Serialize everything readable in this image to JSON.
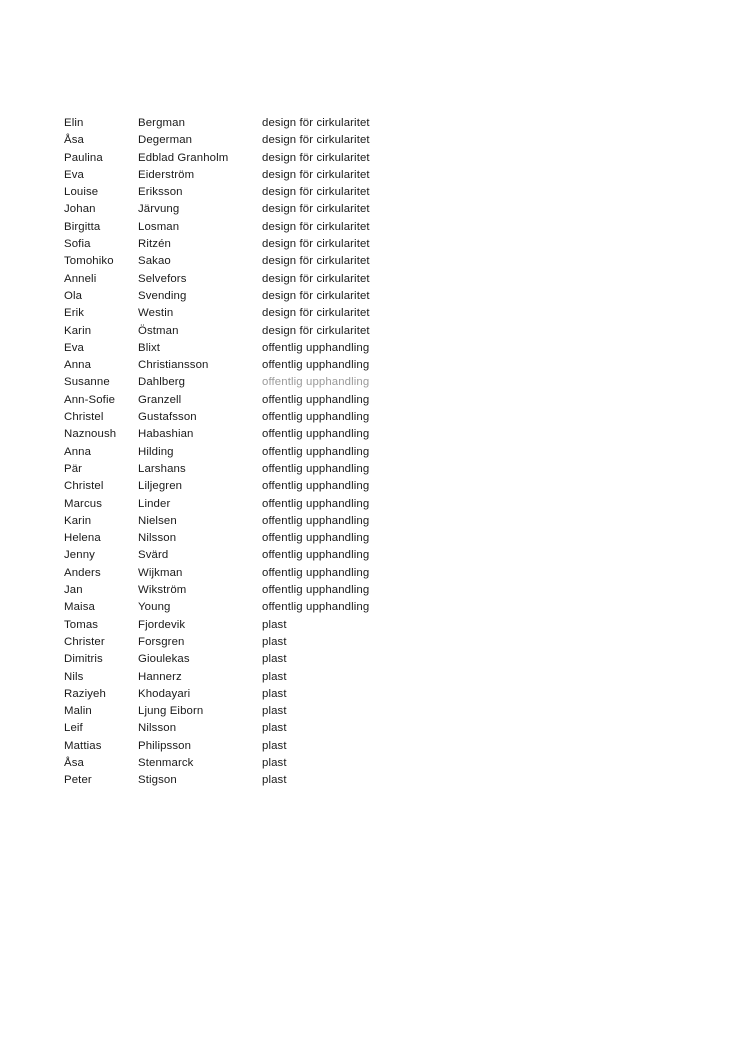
{
  "document": {
    "background_color": "#ffffff",
    "text_color": "#1a1a1a",
    "muted_text_color": "#9a9a9a",
    "columns": [
      "first_name",
      "last_name",
      "topic"
    ],
    "topics": [
      "design för cirkularitet",
      "offentlig upphandling",
      "plast"
    ],
    "rows": [
      {
        "first_name": "Elin",
        "last_name": "Bergman",
        "topic": "design för cirkularitet",
        "muted": false
      },
      {
        "first_name": "Åsa",
        "last_name": "Degerman",
        "topic": "design för cirkularitet",
        "muted": false
      },
      {
        "first_name": "Paulina",
        "last_name": "Edblad Granholm",
        "topic": "design för cirkularitet",
        "muted": false
      },
      {
        "first_name": "Eva",
        "last_name": "Eiderström",
        "topic": "design för cirkularitet",
        "muted": false
      },
      {
        "first_name": "Louise",
        "last_name": "Eriksson",
        "topic": "design för cirkularitet",
        "muted": false
      },
      {
        "first_name": "Johan",
        "last_name": "Järvung",
        "topic": "design för cirkularitet",
        "muted": false
      },
      {
        "first_name": "Birgitta",
        "last_name": "Losman",
        "topic": "design för cirkularitet",
        "muted": false
      },
      {
        "first_name": "Sofia",
        "last_name": "Ritzén",
        "topic": "design för cirkularitet",
        "muted": false
      },
      {
        "first_name": "Tomohiko",
        "last_name": "Sakao",
        "topic": "design för cirkularitet",
        "muted": false
      },
      {
        "first_name": "Anneli",
        "last_name": "Selvefors",
        "topic": "design för cirkularitet",
        "muted": false
      },
      {
        "first_name": "Ola",
        "last_name": "Svending",
        "topic": "design för cirkularitet",
        "muted": false
      },
      {
        "first_name": "Erik",
        "last_name": "Westin",
        "topic": "design för cirkularitet",
        "muted": false
      },
      {
        "first_name": "Karin",
        "last_name": "Östman",
        "topic": "design för cirkularitet",
        "muted": false
      },
      {
        "first_name": "Eva",
        "last_name": "Blixt",
        "topic": "offentlig upphandling",
        "muted": false
      },
      {
        "first_name": "Anna",
        "last_name": "Christiansson",
        "topic": "offentlig upphandling",
        "muted": false
      },
      {
        "first_name": "Susanne",
        "last_name": "Dahlberg",
        "topic": "offentlig upphandling",
        "muted": true
      },
      {
        "first_name": "Ann-Sofie",
        "last_name": "Granzell",
        "topic": "offentlig upphandling",
        "muted": false
      },
      {
        "first_name": "Christel",
        "last_name": "Gustafsson",
        "topic": "offentlig upphandling",
        "muted": false
      },
      {
        "first_name": "Naznoush",
        "last_name": "Habashian",
        "topic": "offentlig upphandling",
        "muted": false
      },
      {
        "first_name": "Anna",
        "last_name": "Hilding",
        "topic": "offentlig upphandling",
        "muted": false
      },
      {
        "first_name": "Pär",
        "last_name": "Larshans",
        "topic": "offentlig upphandling",
        "muted": false
      },
      {
        "first_name": "Christel",
        "last_name": "Liljegren",
        "topic": "offentlig upphandling",
        "muted": false
      },
      {
        "first_name": "Marcus",
        "last_name": "Linder",
        "topic": "offentlig upphandling",
        "muted": false
      },
      {
        "first_name": "Karin",
        "last_name": "Nielsen",
        "topic": "offentlig upphandling",
        "muted": false
      },
      {
        "first_name": "Helena",
        "last_name": "Nilsson",
        "topic": "offentlig upphandling",
        "muted": false
      },
      {
        "first_name": "Jenny",
        "last_name": "Svärd",
        "topic": "offentlig upphandling",
        "muted": false
      },
      {
        "first_name": "Anders",
        "last_name": "Wijkman",
        "topic": "offentlig upphandling",
        "muted": false
      },
      {
        "first_name": "Jan",
        "last_name": "Wikström",
        "topic": "offentlig upphandling",
        "muted": false
      },
      {
        "first_name": "Maisa",
        "last_name": "Young",
        "topic": "offentlig upphandling",
        "muted": false
      },
      {
        "first_name": "Tomas",
        "last_name": "Fjordevik",
        "topic": "plast",
        "muted": false
      },
      {
        "first_name": "Christer",
        "last_name": "Forsgren",
        "topic": "plast",
        "muted": false
      },
      {
        "first_name": "Dimitris",
        "last_name": "Gioulekas",
        "topic": "plast",
        "muted": false
      },
      {
        "first_name": "Nils",
        "last_name": "Hannerz",
        "topic": "plast",
        "muted": false
      },
      {
        "first_name": "Raziyeh",
        "last_name": "Khodayari",
        "topic": "plast",
        "muted": false
      },
      {
        "first_name": "Malin",
        "last_name": "Ljung Eiborn",
        "topic": "plast",
        "muted": false
      },
      {
        "first_name": "Leif",
        "last_name": "Nilsson",
        "topic": "plast",
        "muted": false
      },
      {
        "first_name": "Mattias",
        "last_name": "Philipsson",
        "topic": "plast",
        "muted": false
      },
      {
        "first_name": "Åsa",
        "last_name": "Stenmarck",
        "topic": "plast",
        "muted": false
      },
      {
        "first_name": "Peter",
        "last_name": "Stigson",
        "topic": "plast",
        "muted": false
      }
    ]
  }
}
